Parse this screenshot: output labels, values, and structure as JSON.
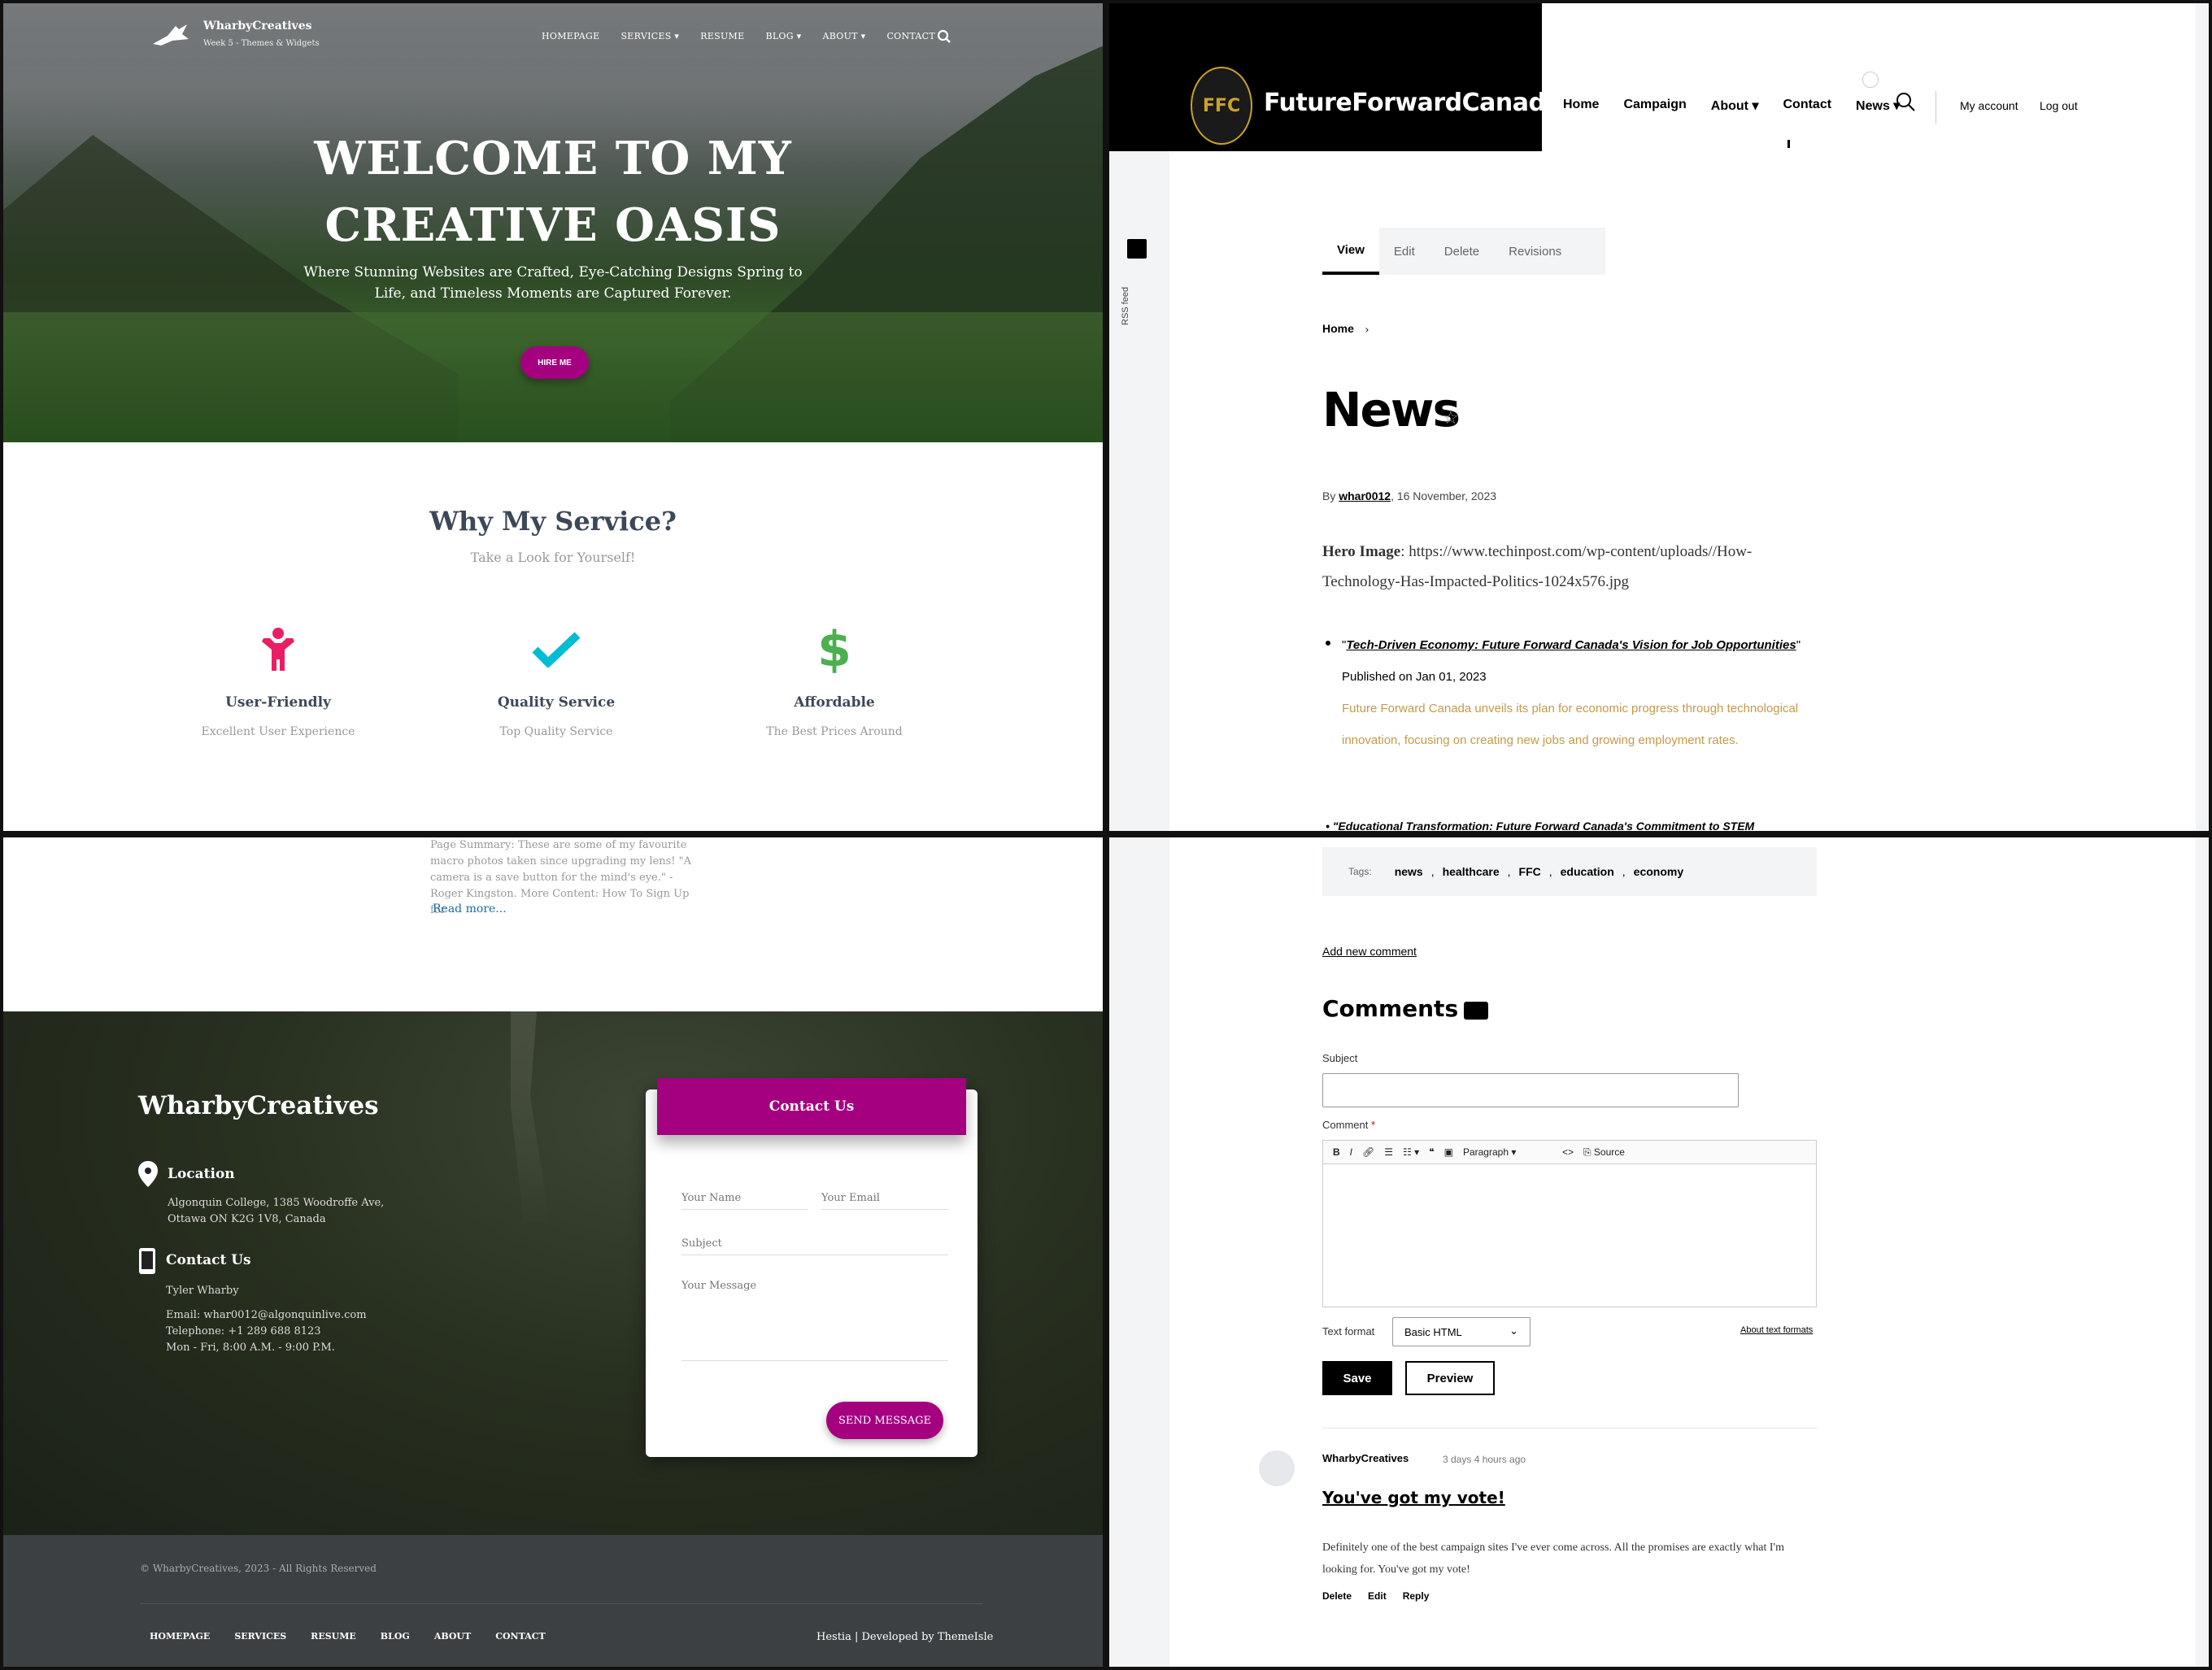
{
  "panel1": {
    "brand": "WharbyCreatives",
    "tagline": "Week 5 - Themes & Widgets",
    "menu": [
      "HOMEPAGE",
      "SERVICES ▾",
      "RESUME",
      "BLOG ▾",
      "ABOUT ▾",
      "CONTACT"
    ],
    "hero_title_line1": "WELCOME TO MY",
    "hero_title_line2": "CREATIVE OASIS",
    "hero_subtitle": "Where Stunning Websites are Crafted, Eye-Catching Designs Spring to Life, and Timeless Moments are Captured Forever.",
    "hire_button": "HIRE ME",
    "section_title": "Why My Service?",
    "section_subtitle": "Take a Look for Yourself!",
    "features": [
      {
        "title": "User-Friendly",
        "desc": "Excellent User Experience",
        "color": "#e91e63"
      },
      {
        "title": "Quality Service",
        "desc": "Top Quality Service",
        "color": "#00bcd4"
      },
      {
        "title": "Affordable",
        "desc": "The Best Prices Around",
        "color": "#4caf50"
      }
    ]
  },
  "panel2": {
    "site_name": "FutureForwardCanada",
    "logo_text": "FFC",
    "menu": [
      "Home",
      "Campaign",
      "About ▾",
      "Contact",
      "News ▾"
    ],
    "my_account": "My account",
    "log_out": "Log out",
    "rss_label": "RSS feed",
    "tabs": [
      "View",
      "Edit",
      "Delete",
      "Revisions"
    ],
    "breadcrumb": "Home",
    "page_title": "News",
    "byline_prefix": "By",
    "author": "whar0012",
    "date": ", 16 November, 2023",
    "hero_label": "Hero Image",
    "hero_url": ": https://www.techinpost.com/wp-content/uploads//How-Technology-Has-Impacted-Politics-1024x576.jpg",
    "article_quote_open": "\"",
    "article_title": "Tech-Driven Economy: Future Forward Canada's Vision for Job Opportunities",
    "article_published": "\" Published on Jan 01, 2023",
    "article_summary": "Future Forward Canada unveils its plan for economic progress through technological innovation, focusing on creating new jobs and growing employment rates.",
    "next_article": "\"Educational Transformation: Future Forward Canada's Commitment to STEM"
  },
  "panel3": {
    "summary": "Page Summary: These are some of my favourite macro photos taken since upgrading my lens! \"A camera is a save button for the mind's eye.\" - Roger Kingston. More Content: How To Sign Up for",
    "read_more": "Read more...",
    "footer_brand": "WharbyCreatives",
    "location_title": "Location",
    "location_address": "Algonquin College, 1385 Woodroffe Ave, Ottawa ON K2G 1V8, Canada",
    "contact_title": "Contact Us",
    "contact_name": "Tyler Wharby",
    "contact_email": "Email: whar0012@algonquinlive.com",
    "contact_phone": "Telephone: +1 289 688 8123",
    "contact_hours": "Mon - Fri, 8:00 A.M. - 9:00 P.M.",
    "form_title": "Contact Us",
    "placeholder_name": "Your Name",
    "placeholder_email": "Your Email",
    "placeholder_subject": "Subject",
    "placeholder_message": "Your Message",
    "send_button": "SEND MESSAGE",
    "copyright": "© WharbyCreatives, 2023 - All Rights Reserved",
    "footer_menu": [
      "HOMEPAGE",
      "SERVICES",
      "RESUME",
      "BLOG",
      "ABOUT",
      "CONTACT"
    ],
    "credit": "Hestia | Developed by ThemeIsle"
  },
  "panel4": {
    "tags_label": "Tags:",
    "tags": [
      "news",
      "healthcare",
      "FFC",
      "education",
      "economy"
    ],
    "add_comment": "Add new comment",
    "comments_title": "Comments",
    "subject_label": "Subject",
    "comment_label": "Comment",
    "required_mark": "*",
    "toolbar": {
      "bold": "B",
      "italic": "I",
      "paragraph": "Paragraph",
      "source": "Source"
    },
    "text_format_label": "Text format",
    "text_format_value": "Basic HTML",
    "about_formats": "About text formats",
    "save": "Save",
    "preview": "Preview",
    "comment_author": "WharbyCreatives",
    "comment_time": "3 days 4 hours ago",
    "comment_title": "You've got my vote!",
    "comment_body": "Definitely one of the best campaign sites I've ever come across. All the promises are exactly what I'm looking for. You've got my vote!",
    "comment_actions": [
      "Delete",
      "Edit",
      "Reply"
    ]
  },
  "colors": {
    "accent_magenta": "#a4007f",
    "footer_bar": "#3c4043",
    "rail_gray": "#f3f4f6",
    "summary_gold": "#c49a4a"
  }
}
